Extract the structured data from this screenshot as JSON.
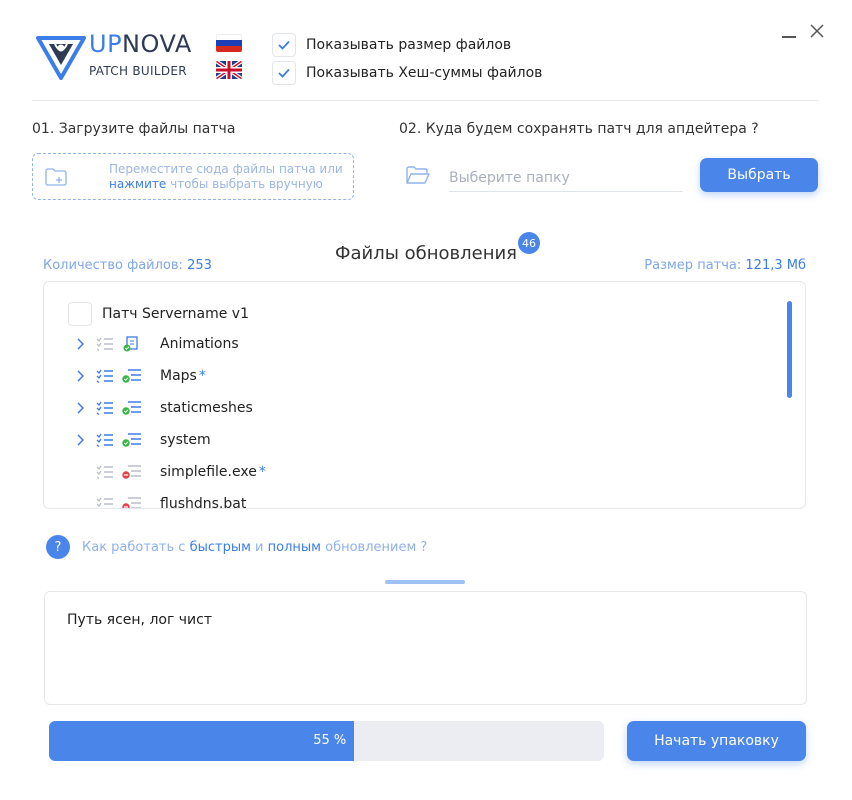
{
  "brand": {
    "name_part1": "UP",
    "name_part2": "NOVA",
    "subtitle": "PATCH BUILDER",
    "accent_color": "#3b7de9"
  },
  "languages": [
    {
      "flag": "ru-flag-icon"
    },
    {
      "flag": "gb-flag-icon"
    }
  ],
  "options": {
    "show_size": {
      "label": "Показывать размер файлов",
      "checked": true
    },
    "show_hash": {
      "label": "Показывать Хеш-суммы файлов",
      "checked": true
    }
  },
  "window": {
    "minimize": "minimize-icon",
    "close": "close-icon"
  },
  "upload": {
    "title": "01. Загрузите файлы патча",
    "drop_text_1": "Переместите сюда файлы патча или",
    "drop_link": "нажмите",
    "drop_text_2": "чтобы выбрать вручную"
  },
  "destination": {
    "title": "02. Куда будем сохранять патч для апдейтера ?",
    "placeholder": "Выберите папку",
    "value": "",
    "button": "Выбрать"
  },
  "files": {
    "heading": "Файлы обновления",
    "badge": "46",
    "count_label": "Количество файлов:",
    "count_value": "253",
    "size_label": "Размер патча:",
    "size_value": "121,3 Мб"
  },
  "tree": {
    "root": {
      "label": "Патч Servername v1",
      "checked": false
    },
    "rows": [
      {
        "label": "Animations",
        "star": "",
        "expandable": true,
        "status": "ok"
      },
      {
        "label": "Maps",
        "star": "*",
        "expandable": true,
        "status": "ok"
      },
      {
        "label": "staticmeshes",
        "star": "",
        "expandable": true,
        "status": "ok"
      },
      {
        "label": "system",
        "star": "",
        "expandable": true,
        "status": "ok"
      },
      {
        "label": "simplefile.exe",
        "star": "*",
        "expandable": false,
        "status": "removed"
      },
      {
        "label": "flushdns.bat",
        "star": "",
        "expandable": false,
        "status": "removed"
      }
    ]
  },
  "help": {
    "icon": "?",
    "text_1": "Как работать с",
    "link_1": "быстрым",
    "text_2": "и",
    "link_2": "полным",
    "text_3": "обновлением ?"
  },
  "log": {
    "text": "Путь ясен, лог чист"
  },
  "progress": {
    "value": 0.55,
    "label": "55 %"
  },
  "actions": {
    "pack_button": "Начать упаковку"
  }
}
